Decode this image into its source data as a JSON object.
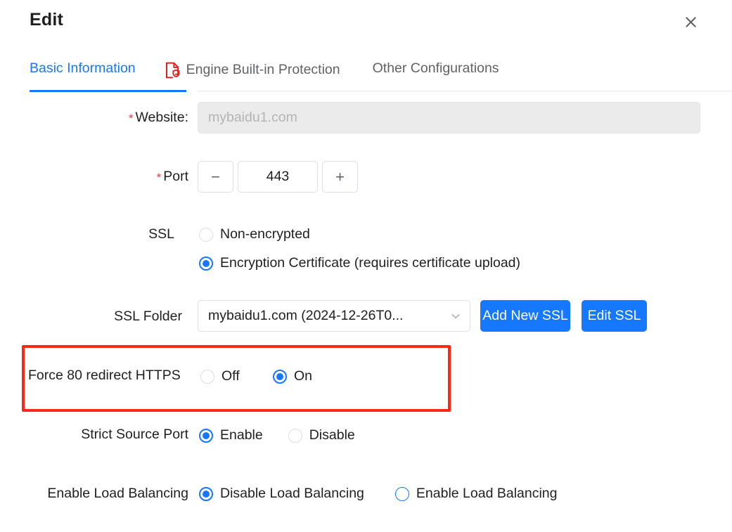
{
  "dialog": {
    "title": "Edit",
    "close_icon": "close-icon"
  },
  "tabs": [
    {
      "label": "Basic Information",
      "active": true,
      "icon": null
    },
    {
      "label": "Engine Built-in Protection",
      "active": false,
      "icon": "document-shield-icon"
    },
    {
      "label": "Other Configurations",
      "active": false,
      "icon": null
    }
  ],
  "form": {
    "website": {
      "label": "Website:",
      "required_marker": "*",
      "value": "",
      "placeholder": "mybaidu1.com",
      "disabled": true
    },
    "port": {
      "label": "Port",
      "required_marker": "*",
      "value": "443",
      "decrement_label": "−",
      "increment_label": "+"
    },
    "ssl": {
      "label": "SSL",
      "options": [
        {
          "label": "Non-encrypted",
          "checked": false
        },
        {
          "label": "Encryption Certificate (requires certificate upload)",
          "checked": true
        }
      ]
    },
    "ssl_folder": {
      "label": "SSL Folder",
      "selected": "mybaidu1.com (2024-12-26T0...",
      "caret_icon": "chevron-down-icon",
      "add_button": "Add New SSL",
      "edit_button": "Edit SSL"
    },
    "force_80_redirect": {
      "label": "Force 80 redirect HTTPS",
      "options": [
        {
          "label": "Off",
          "checked": false
        },
        {
          "label": "On",
          "checked": true
        }
      ]
    },
    "strict_source_port": {
      "label": "Strict Source Port",
      "options": [
        {
          "label": "Enable",
          "checked": true
        },
        {
          "label": "Disable",
          "checked": false
        }
      ]
    },
    "load_balancing": {
      "label": "Enable Load Balancing",
      "options": [
        {
          "label": "Disable Load Balancing",
          "checked": true
        },
        {
          "label": "Enable Load Balancing",
          "checked": false
        }
      ]
    }
  },
  "colors": {
    "accent_blue": "#1677ff",
    "highlight_red": "#fb2717",
    "required_star_red": "#e4393c",
    "icon_red": "#e02020",
    "disabled_bg": "#ebebeb"
  }
}
